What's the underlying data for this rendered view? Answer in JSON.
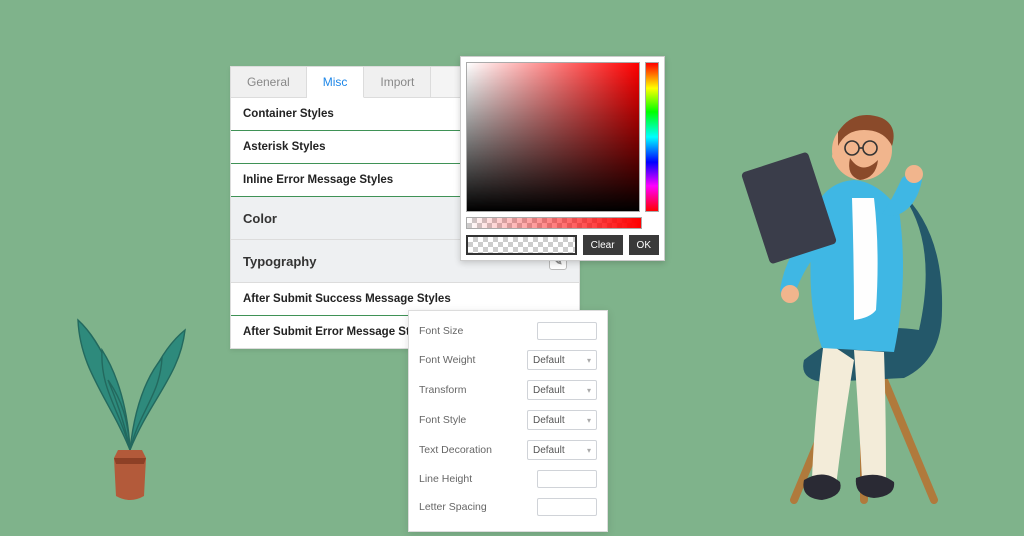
{
  "tabs": {
    "general": "General",
    "misc": "Misc",
    "import": "Import"
  },
  "sections": {
    "container": "Container Styles",
    "asterisk": "Asterisk Styles",
    "inline_error": "Inline Error Message Styles",
    "color": "Color",
    "typography": "Typography",
    "after_success": "After Submit Success Message Styles",
    "after_error": "After Submit Error Message Styles"
  },
  "typo": {
    "font_size": "Font Size",
    "font_weight": "Font Weight",
    "transform": "Transform",
    "font_style": "Font Style",
    "text_decoration": "Text Decoration",
    "line_height": "Line Height",
    "letter_spacing": "Letter Spacing",
    "default": "Default"
  },
  "picker": {
    "clear": "Clear",
    "ok": "OK"
  }
}
